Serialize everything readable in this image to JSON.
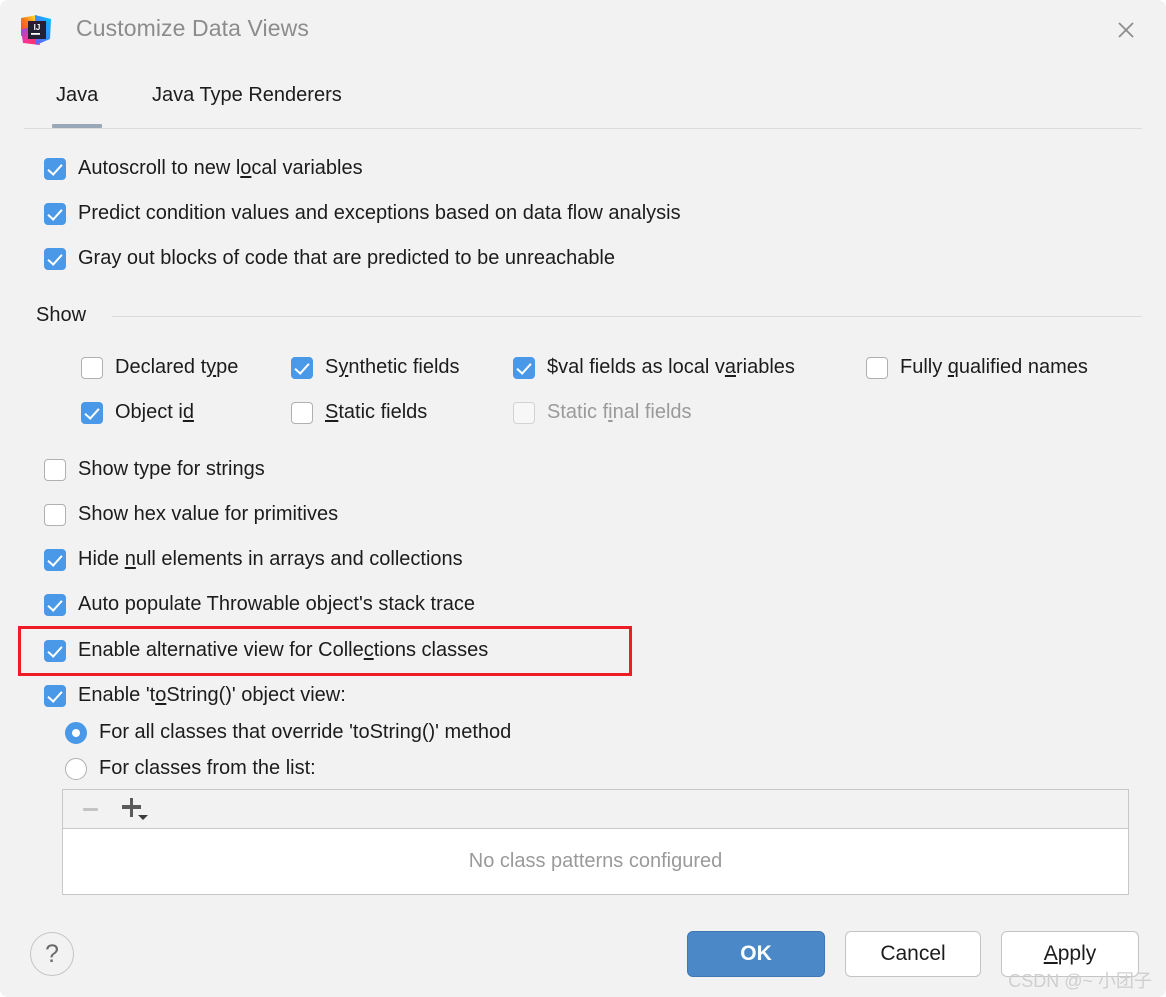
{
  "window": {
    "title": "Customize Data Views",
    "icon": "intellij-idea-logo",
    "close_icon": "close-icon"
  },
  "tabs": [
    {
      "label": "Java",
      "active": true
    },
    {
      "label": "Java Type Renderers",
      "active": false
    }
  ],
  "top_options": [
    {
      "label_pre": "Autoscroll to new l",
      "mnemonic": "o",
      "label_post": "cal variables",
      "checked": true
    },
    {
      "label_pre": "Predict condition values and exceptions based on data flow analysis",
      "mnemonic": "",
      "label_post": "",
      "checked": true
    },
    {
      "label_pre": "Gray out blocks of code that are predicted to be unreachable",
      "mnemonic": "",
      "label_post": "",
      "checked": true
    }
  ],
  "show_group": {
    "title": "Show",
    "row1": [
      {
        "label_pre": "Declared t",
        "mnemonic": "y",
        "label_post": "pe",
        "checked": false,
        "enabled": true
      },
      {
        "label_pre": "S",
        "mnemonic": "y",
        "label_post": "nthetic fields",
        "checked": true,
        "enabled": true
      },
      {
        "label_pre": "$val fields as local v",
        "mnemonic": "a",
        "label_post": "riables",
        "checked": true,
        "enabled": true
      },
      {
        "label_pre": "Fully ",
        "mnemonic": "q",
        "label_post": "ualified names",
        "checked": false,
        "enabled": true
      }
    ],
    "row2": [
      {
        "label_pre": "Object i",
        "mnemonic": "d",
        "label_post": "",
        "checked": true,
        "enabled": true
      },
      {
        "label_pre": "",
        "mnemonic": "S",
        "label_post": "tatic fields",
        "checked": false,
        "enabled": true
      },
      {
        "label_pre": "Static f",
        "mnemonic": "i",
        "label_post": "nal fields",
        "checked": false,
        "enabled": false
      }
    ]
  },
  "mid_options": [
    {
      "label_pre": "Show type for strings",
      "mnemonic": "",
      "label_post": "",
      "checked": false
    },
    {
      "label_pre": "Show hex value for primitives",
      "mnemonic": "",
      "label_post": "",
      "checked": false
    },
    {
      "label_pre": "Hide ",
      "mnemonic": "n",
      "label_post": "ull elements in arrays and collections",
      "checked": true
    },
    {
      "label_pre": "Auto populate Throwable object's stack trace",
      "mnemonic": "",
      "label_post": "",
      "checked": true
    }
  ],
  "highlighted_option": {
    "label_pre": "Enable alternative view for Colle",
    "mnemonic": "c",
    "label_post": "tions classes",
    "checked": true,
    "highlight_color": "#ee1c24"
  },
  "tostring_option": {
    "label_pre": "Enable 't",
    "mnemonic": "o",
    "label_post": "String()' object view:",
    "checked": true
  },
  "tostring_radios": [
    {
      "label": "For all classes that override 'toString()' method",
      "selected": true
    },
    {
      "label": "For classes from the list:",
      "selected": false
    }
  ],
  "class_list": {
    "remove_button": "remove-icon",
    "add_button": "add-icon",
    "empty_text": "No class patterns configured"
  },
  "footer": {
    "help_label": "?",
    "ok_label": "OK",
    "cancel_label": "Cancel",
    "apply_pre": "",
    "apply_mnemonic": "A",
    "apply_post": "pply"
  },
  "watermark": "CSDN @~ 小团子"
}
